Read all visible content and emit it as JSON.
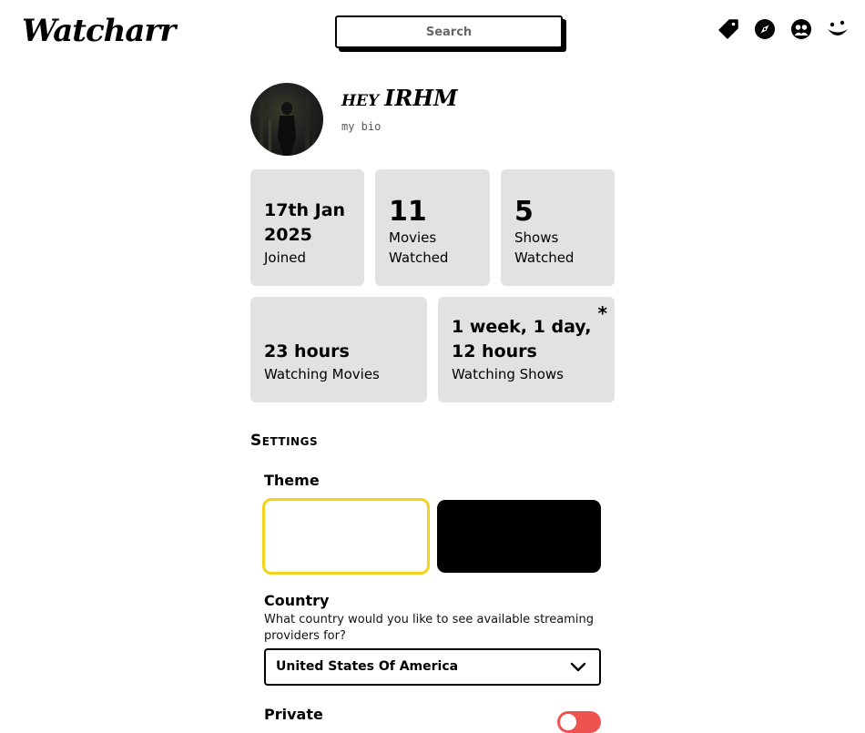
{
  "header": {
    "logo": "Watcharr",
    "search_placeholder": "Search",
    "icons": [
      "tag-icon",
      "compass-icon",
      "people-icon",
      "face-icon"
    ]
  },
  "profile": {
    "greeting_prefix": "HEY",
    "username": "IRHM",
    "bio": "my bio"
  },
  "stats": {
    "joined_value": "17th Jan 2025",
    "joined_label": "Joined",
    "movies_value": "11",
    "movies_label": "Movies Watched",
    "shows_value": "5",
    "shows_label": "Shows Watched",
    "movie_time_value": "23 hours",
    "movie_time_label": "Watching Movies",
    "show_time_value": "1 week, 1 day, 12 hours",
    "show_time_label": "Watching Shows",
    "note_marker": "*"
  },
  "settings": {
    "title": "Settings",
    "theme_label": "Theme",
    "theme_options": [
      "light",
      "dark"
    ],
    "theme_selected": "light",
    "country_label": "Country",
    "country_description": "What country would you like to see available streaming providers for?",
    "country_value": "United States Of America",
    "private_label": "Private"
  },
  "colors": {
    "card_bg": "#e2e2e2",
    "theme_selected_border": "#f4d21b",
    "toggle_on": "#ef5350"
  }
}
